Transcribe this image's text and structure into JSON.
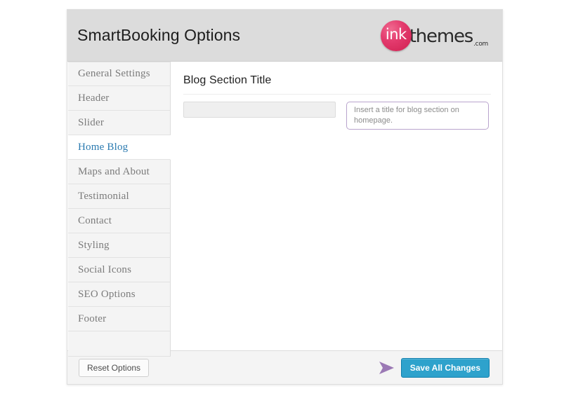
{
  "header": {
    "title": "SmartBooking Options",
    "logo": {
      "mark_text": "ink",
      "word": "themes",
      "suffix": ".com",
      "circle_color": "#e33a6d",
      "word_color": "#2a2a2a"
    }
  },
  "sidebar": {
    "active_index": 3,
    "items": [
      {
        "label": "General Settings"
      },
      {
        "label": "Header"
      },
      {
        "label": "Slider"
      },
      {
        "label": "Home Blog"
      },
      {
        "label": "Maps and About"
      },
      {
        "label": "Testimonial"
      },
      {
        "label": "Contact"
      },
      {
        "label": "Styling"
      },
      {
        "label": "Social Icons"
      },
      {
        "label": "SEO Options"
      },
      {
        "label": "Footer"
      },
      {
        "label": ""
      }
    ]
  },
  "content": {
    "section_title": "Blog Section Title",
    "blog_title_field": {
      "value": "",
      "placeholder": ""
    },
    "help_text": "Insert a title for blog section on homepage."
  },
  "footer": {
    "reset_label": "Reset Options",
    "save_label": "Save All Changes",
    "save_button_color": "#2ea2cc",
    "cursor_arrow_color": "#9b79b5"
  }
}
